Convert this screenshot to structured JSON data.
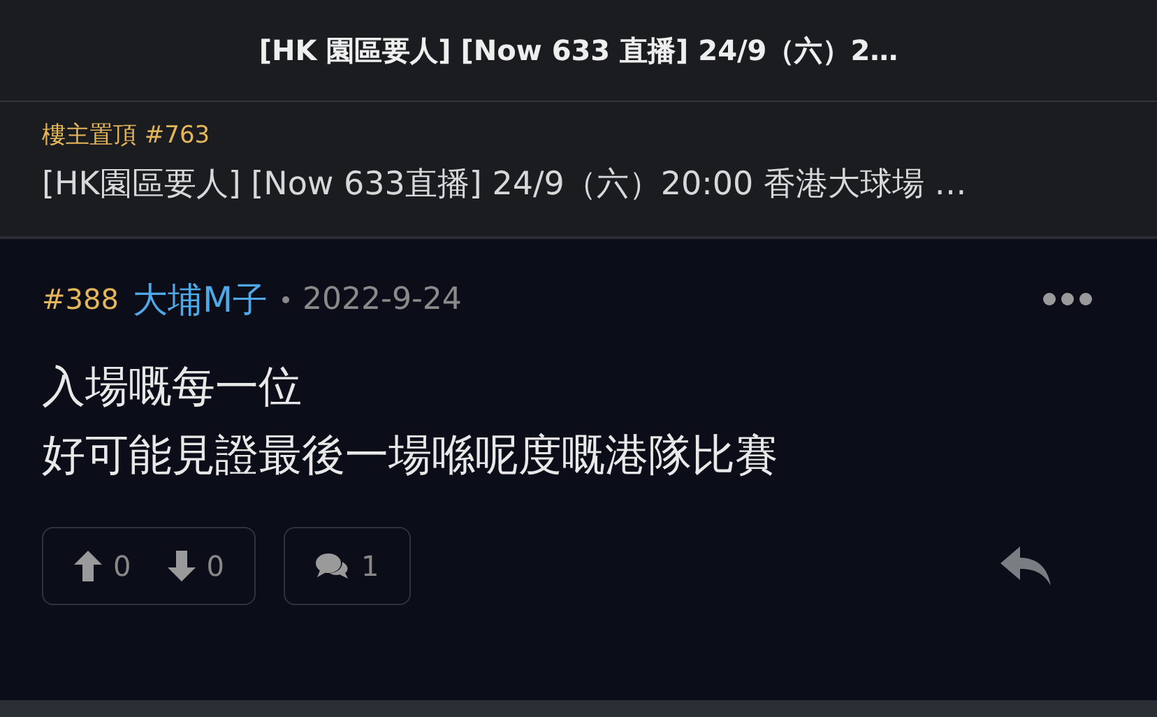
{
  "header": {
    "title": "[HK 園區要人] [Now 633 直播] 24/9（六）2…"
  },
  "pinned": {
    "label": "樓主置頂 #763",
    "text": "[HK園區要人] [Now 633直播] 24/9（六）20:00 香港大球場 …"
  },
  "post": {
    "floor": "#388",
    "author": "大埔M子",
    "date": "2022-9-24",
    "lines": [
      "入場嘅每一位",
      "好可能見證最後一場喺呢度嘅港隊比賽"
    ],
    "upvotes": "0",
    "downvotes": "0",
    "replies": "1"
  }
}
